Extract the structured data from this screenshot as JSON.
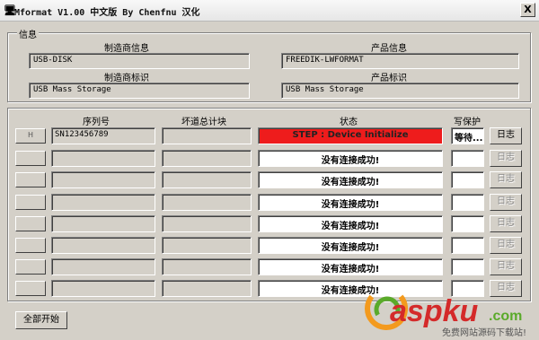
{
  "window": {
    "title": "Mformat V1.00 中文版 By Chenfnu 汉化",
    "close_label": "X"
  },
  "info": {
    "caption": "信息",
    "manufacturer_info_label": "制造商信息",
    "manufacturer_info_value": "USB-DISK",
    "product_info_label": "产品信息",
    "product_info_value": "FREEDIK-LWFORMAT",
    "manufacturer_id_label": "制造商标识",
    "manufacturer_id_value": "USB Mass Storage",
    "product_id_label": "产品标识",
    "product_id_value": "USB Mass Storage"
  },
  "table": {
    "headers": {
      "serial": "序列号",
      "bad_blocks": "坏道总计块",
      "status": "状态",
      "write_protect": "写保护"
    },
    "rows": [
      {
        "button": "H",
        "serial": "SN123456789",
        "bad_blocks": "",
        "status": "STEP : Device Initialize",
        "write_protect": "等待...",
        "log": "日志"
      },
      {
        "button": "",
        "serial": "",
        "bad_blocks": "",
        "status": "没有连接成功!",
        "write_protect": "",
        "log": "日志"
      },
      {
        "button": "",
        "serial": "",
        "bad_blocks": "",
        "status": "没有连接成功!",
        "write_protect": "",
        "log": "日志"
      },
      {
        "button": "",
        "serial": "",
        "bad_blocks": "",
        "status": "没有连接成功!",
        "write_protect": "",
        "log": "日志"
      },
      {
        "button": "",
        "serial": "",
        "bad_blocks": "",
        "status": "没有连接成功!",
        "write_protect": "",
        "log": "日志"
      },
      {
        "button": "",
        "serial": "",
        "bad_blocks": "",
        "status": "没有连接成功!",
        "write_protect": "",
        "log": "日志"
      },
      {
        "button": "",
        "serial": "",
        "bad_blocks": "",
        "status": "没有连接成功!",
        "write_protect": "",
        "log": "日志"
      },
      {
        "button": "",
        "serial": "",
        "bad_blocks": "",
        "status": "没有连接成功!",
        "write_protect": "",
        "log": "日志"
      }
    ]
  },
  "footer": {
    "start_all_label": "全部开始"
  },
  "watermark": {
    "brand_text": "aspku",
    "tld_text": ".com",
    "tagline": "免费网站源码下载站!"
  },
  "colors": {
    "active_status": "#ee1c1c",
    "window_bg": "#d4d0c8",
    "watermark_orange": "#f39a1e",
    "watermark_green": "#5aaa2a",
    "watermark_red": "#d42a2a"
  }
}
